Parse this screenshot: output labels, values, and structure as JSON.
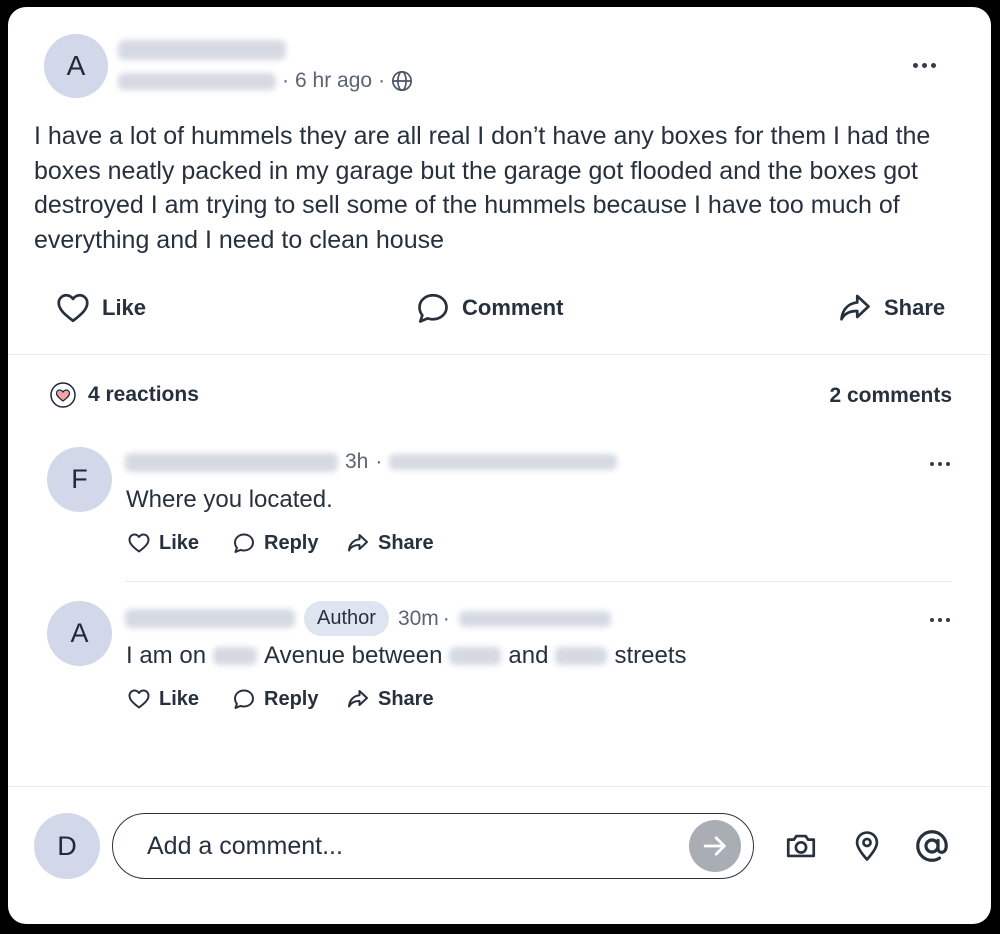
{
  "post": {
    "author_initial": "A",
    "time": "6 hr ago",
    "text": "I have a lot of hummels they are all real I don’t have any boxes for them I had the boxes neatly packed in my garage but the garage got flooded and the boxes got destroyed I am trying to sell some of the hummels because I have too much of everything and I need to clean house"
  },
  "actions": {
    "like": "Like",
    "comment": "Comment",
    "share": "Share"
  },
  "stats": {
    "reactions": "4 reactions",
    "comments": "2 comments"
  },
  "comments": [
    {
      "initial": "F",
      "time": "3h",
      "text": "Where you located.",
      "like": "Like",
      "reply": "Reply",
      "share": "Share"
    },
    {
      "initial": "A",
      "badge": "Author",
      "time": "30m",
      "text_parts": [
        "I am on",
        "Avenue between",
        "and",
        "streets"
      ],
      "like": "Like",
      "reply": "Reply",
      "share": "Share"
    }
  ],
  "composer": {
    "user_initial": "D",
    "placeholder": "Add a comment..."
  },
  "colors": {
    "avatar_bg": "#d2d8e9",
    "text": "#27313e",
    "send_button": "#a9aeb5",
    "reaction_heart": "#f4a3a3"
  },
  "icons": [
    "heart-icon",
    "speech-bubble-icon",
    "share-arrow-icon",
    "globe-icon",
    "more-options-icon",
    "send-arrow-icon",
    "camera-icon",
    "location-pin-icon",
    "at-sign-icon"
  ]
}
